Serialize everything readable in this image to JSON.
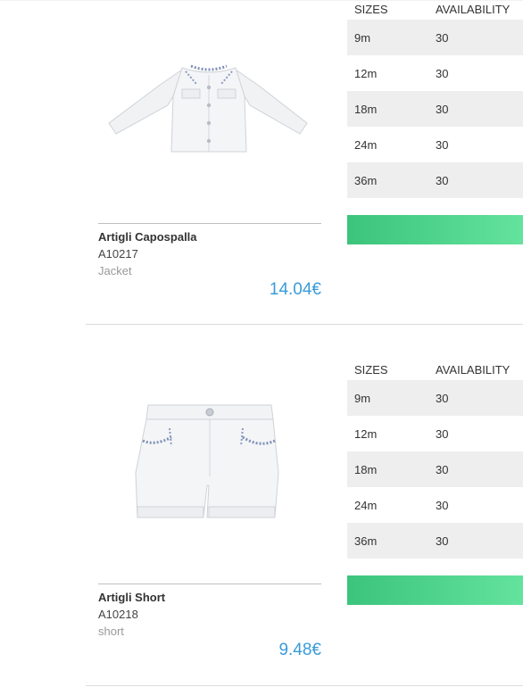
{
  "table_headers": {
    "sizes": "SIZES",
    "availability": "AVAILABILITY"
  },
  "products": [
    {
      "name": "Artigli Capospalla",
      "code": "A10217",
      "category": "Jacket",
      "price": "14.04€",
      "image_icon": "jacket-image",
      "sizes": [
        {
          "size": "9m",
          "availability": "30"
        },
        {
          "size": "12m",
          "availability": "30"
        },
        {
          "size": "18m",
          "availability": "30"
        },
        {
          "size": "24m",
          "availability": "30"
        },
        {
          "size": "36m",
          "availability": "30"
        }
      ]
    },
    {
      "name": "Artigli Short",
      "code": "A10218",
      "category": "short",
      "price": "9.48€",
      "image_icon": "shorts-image",
      "sizes": [
        {
          "size": "9m",
          "availability": "30"
        },
        {
          "size": "12m",
          "availability": "30"
        },
        {
          "size": "18m",
          "availability": "30"
        },
        {
          "size": "24m",
          "availability": "30"
        },
        {
          "size": "36m",
          "availability": "30"
        }
      ]
    }
  ],
  "colors": {
    "price": "#3a9bd9",
    "button_start": "#3cc47c",
    "button_end": "#63e39d",
    "row_shade": "#eeeeee"
  }
}
